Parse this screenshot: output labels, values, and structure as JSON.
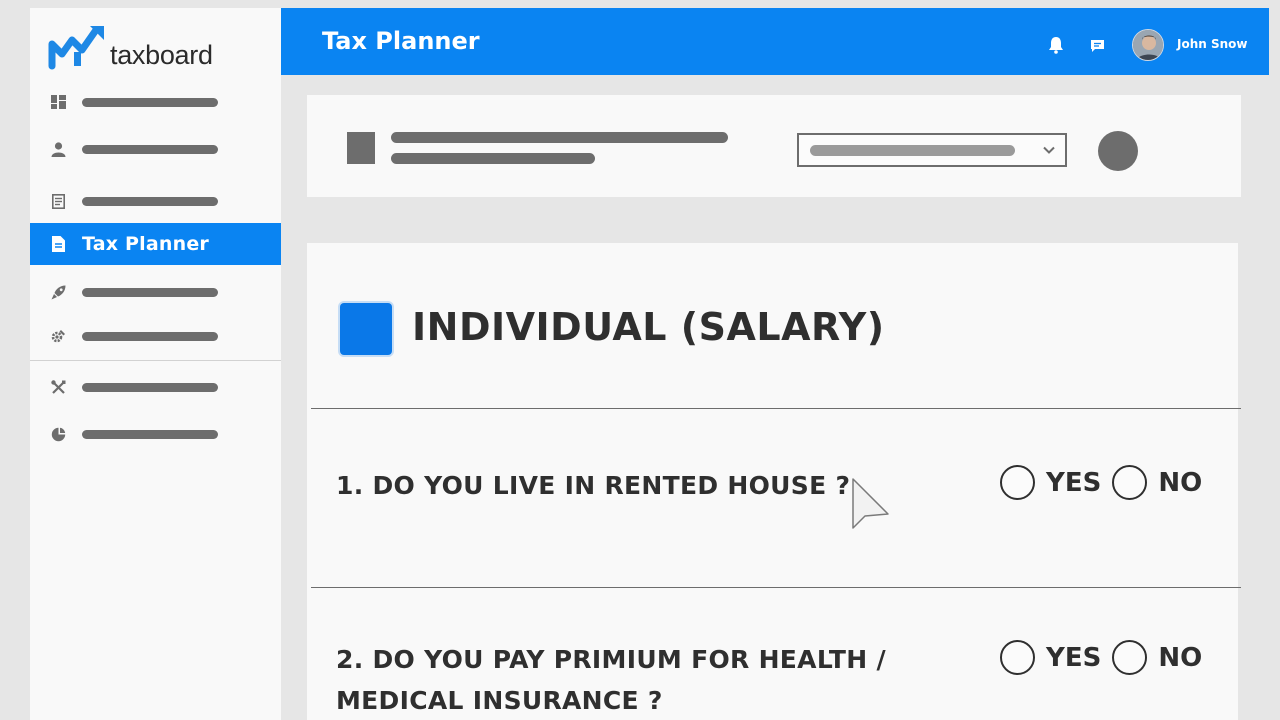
{
  "brand": {
    "name": "taxboard",
    "accent": "#0a84f2"
  },
  "sidebar": {
    "items": [
      {
        "icon": "dashboard-icon",
        "label": ""
      },
      {
        "icon": "user-icon",
        "label": ""
      },
      {
        "icon": "document-icon",
        "label": ""
      },
      {
        "icon": "file-text-icon",
        "label": "Tax Planner",
        "active": true
      },
      {
        "icon": "rocket-icon",
        "label": ""
      },
      {
        "icon": "settings-icon",
        "label": ""
      },
      {
        "icon": "tools-icon",
        "label": ""
      },
      {
        "icon": "pie-chart-icon",
        "label": ""
      }
    ]
  },
  "header": {
    "title": "Tax Planner",
    "user_name": "John Snow",
    "icons": [
      "bell-icon",
      "chat-icon"
    ]
  },
  "form": {
    "section_title": "INDIVIDUAL (SALARY)",
    "questions": [
      {
        "line1": "1. DO YOU LIVE IN RENTED HOUSE ?",
        "line2": "",
        "options": [
          "YES",
          "NO"
        ]
      },
      {
        "line1": "2. DO YOU PAY PRIMIUM FOR HEALTH /",
        "line2": "MEDICAL INSURANCE ?",
        "options": [
          "YES",
          "NO"
        ]
      }
    ]
  }
}
